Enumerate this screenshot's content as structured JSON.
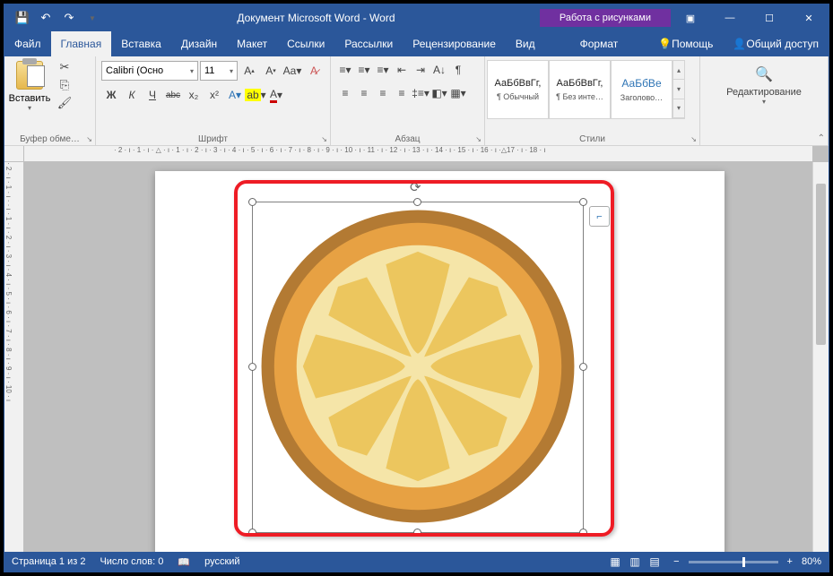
{
  "title": "Документ Microsoft Word - Word",
  "picture_tools": "Работа с рисунками",
  "tabs": {
    "file": "Файл",
    "home": "Главная",
    "insert": "Вставка",
    "design": "Дизайн",
    "layout": "Макет",
    "references": "Ссылки",
    "mailings": "Рассылки",
    "review": "Рецензирование",
    "view": "Вид",
    "format": "Формат",
    "tell_me": "Помощь",
    "share": "Общий доступ"
  },
  "ribbon": {
    "clipboard": {
      "label": "Буфер обме…",
      "paste": "Вставить"
    },
    "font": {
      "label": "Шрифт",
      "name": "Calibri (Осно",
      "size": "11",
      "bold": "Ж",
      "italic": "К",
      "underline": "Ч",
      "strike": "abc",
      "sub": "x₂",
      "sup": "x²"
    },
    "paragraph": {
      "label": "Абзац"
    },
    "styles": {
      "label": "Стили",
      "items": [
        {
          "preview": "АаБбВвГг,",
          "name": "¶ Обычный"
        },
        {
          "preview": "АаБбВвГг,",
          "name": "¶ Без инте…"
        },
        {
          "preview": "АаБбВе",
          "name": "Заголово…"
        }
      ]
    },
    "editing": {
      "label": "Редактирование"
    }
  },
  "ruler_h": "· 2 · ı · 1 · ı · △ · ı · 1 · ı · 2 · ı · 3 · ı · 4 · ı · 5 · ı · 6 · ı · 7 · ı · 8 · ı · 9 · ı · 10 · ı · 11 · ı · 12 · ı · 13 · ı · 14 · ı · 15 · ı · 16 · ı ·△17 · ı · 18 · ı",
  "ruler_v": "· 2 · ı · 1 · ı · · ı · 1 · ı · 2 · ı · 3 · ı · 4 · ı · 5 · ı · 6 · ı · 7 · ı · 8 · ı · 9 · ı · 10 · ı",
  "status": {
    "page": "Страница 1 из 2",
    "words": "Число слов: 0",
    "lang": "русский",
    "zoom": "80%"
  }
}
